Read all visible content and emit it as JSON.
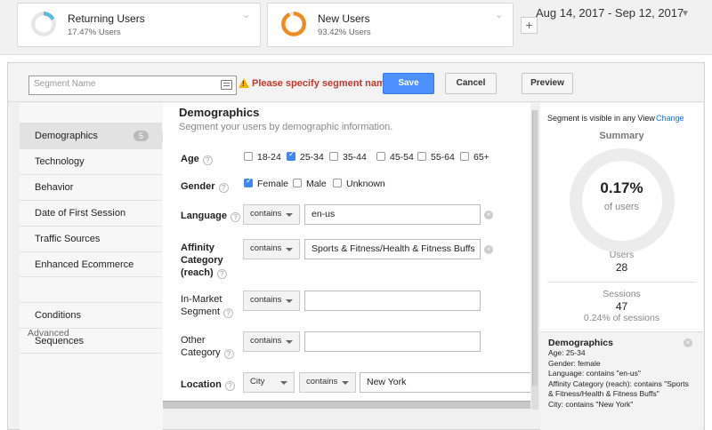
{
  "segments": [
    {
      "name": "Returning Users",
      "subtitle": "17.47% Users",
      "ring_color": "#5bb8e6",
      "pct": 0.1747
    },
    {
      "name": "New Users",
      "subtitle": "93.42% Users",
      "ring_color": "#f0891e",
      "pct": 0.9342
    }
  ],
  "add_segment_label": "+",
  "date_range": "Aug 14, 2017 - Sep 12, 2017",
  "header": {
    "segment_name_placeholder": "Segment Name",
    "warning": "Please specify segment name",
    "save": "Save",
    "cancel": "Cancel",
    "preview": "Preview"
  },
  "sidebar": {
    "items": [
      {
        "label": "Demographics",
        "badge": "5",
        "active": true
      },
      {
        "label": "Technology"
      },
      {
        "label": "Behavior"
      },
      {
        "label": "Date of First Session"
      },
      {
        "label": "Traffic Sources"
      },
      {
        "label": "Enhanced Ecommerce"
      }
    ],
    "advanced_label": "Advanced",
    "advanced_items": [
      {
        "label": "Conditions"
      },
      {
        "label": "Sequences"
      }
    ]
  },
  "main": {
    "title": "Demographics",
    "subtitle": "Segment your users by demographic information.",
    "age": {
      "label": "Age",
      "options": [
        {
          "label": "18-24",
          "checked": false
        },
        {
          "label": "25-34",
          "checked": true
        },
        {
          "label": "35-44",
          "checked": false
        },
        {
          "label": "45-54",
          "checked": false
        },
        {
          "label": "55-64",
          "checked": false
        },
        {
          "label": "65+",
          "checked": false
        }
      ]
    },
    "gender": {
      "label": "Gender",
      "options": [
        {
          "label": "Female",
          "checked": true
        },
        {
          "label": "Male",
          "checked": false
        },
        {
          "label": "Unknown",
          "checked": false
        }
      ]
    },
    "language": {
      "label": "Language",
      "op": "contains",
      "value": "en-us"
    },
    "affinity": {
      "label_lines": [
        "Affinity",
        "Category",
        "(reach)"
      ],
      "op": "contains",
      "value": "Sports & Fitness/Health & Fitness Buffs"
    },
    "inmarket": {
      "label_lines": [
        "In-Market",
        "Segment"
      ],
      "op": "contains",
      "value": ""
    },
    "other": {
      "label_lines": [
        "Other",
        "Category"
      ],
      "op": "contains",
      "value": ""
    },
    "location": {
      "label": "Location",
      "field": "City",
      "op": "contains",
      "value": "New York"
    },
    "help_glyph": "?"
  },
  "summary": {
    "visibility": "Segment is visible in any View",
    "change": "Change",
    "title": "Summary",
    "pct": "0.17%",
    "pct_label": "of users",
    "users_label": "Users",
    "users": "28",
    "sessions_label": "Sessions",
    "sessions": "47",
    "sessions_pct": "0.24% of sessions",
    "ring_fraction": 0.0017
  },
  "description": {
    "title": "Demographics",
    "lines": [
      "Age: 25-34",
      "Gender: female",
      "Language: contains \"en-us\"",
      "Affinity Category (reach): contains \"Sports & Fitness/Health & Fitness Buffs\"",
      "City: contains \"New York\""
    ]
  },
  "colors": {
    "accent": "#4d90fe",
    "warning": "#c0392b",
    "link": "#1a73e8"
  }
}
